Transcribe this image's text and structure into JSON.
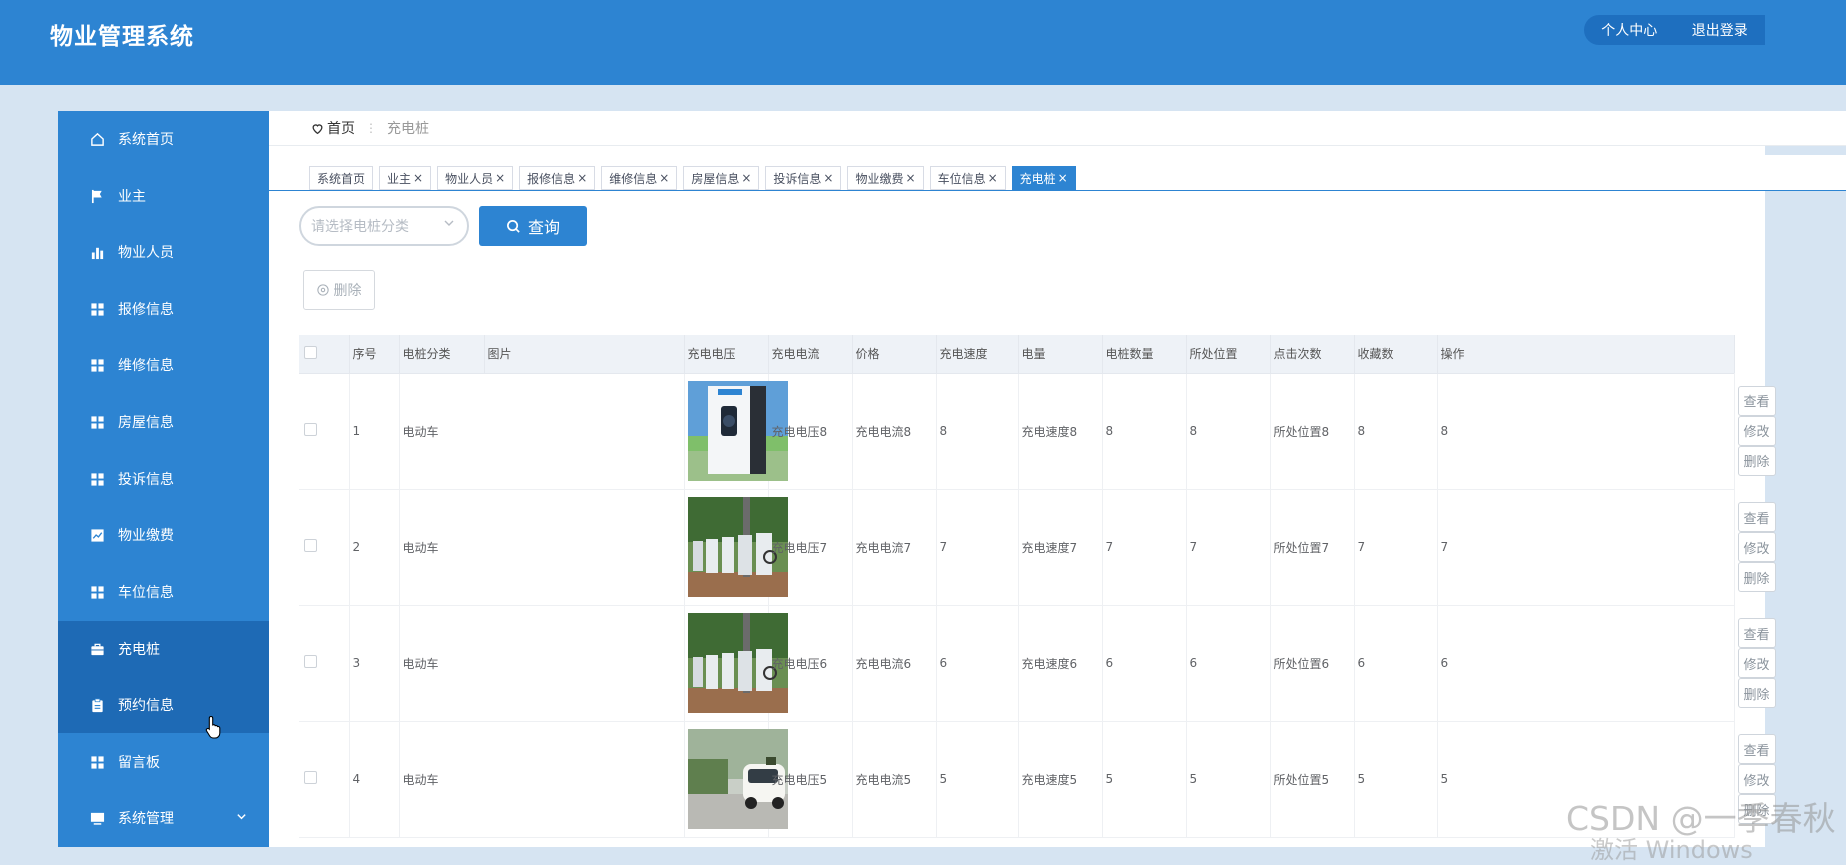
{
  "header": {
    "title": "物业管理系统",
    "nav": [
      "个人中心",
      "退出登录"
    ]
  },
  "sidebar": {
    "items": [
      {
        "label": "系统首页",
        "icon": "home-icon"
      },
      {
        "label": "业主",
        "icon": "flag-icon"
      },
      {
        "label": "物业人员",
        "icon": "bar-chart-icon"
      },
      {
        "label": "报修信息",
        "icon": "grid-icon"
      },
      {
        "label": "维修信息",
        "icon": "grid-icon"
      },
      {
        "label": "房屋信息",
        "icon": "grid-icon"
      },
      {
        "label": "投诉信息",
        "icon": "grid-icon"
      },
      {
        "label": "物业缴费",
        "icon": "trend-icon"
      },
      {
        "label": "车位信息",
        "icon": "grid-icon"
      },
      {
        "label": "充电桩",
        "icon": "briefcase-icon",
        "active": true
      },
      {
        "label": "预约信息",
        "icon": "clipboard-icon",
        "hover": true
      },
      {
        "label": "留言板",
        "icon": "grid-icon"
      },
      {
        "label": "系统管理",
        "icon": "monitor-icon",
        "expandable": true
      }
    ]
  },
  "breadcrumb": {
    "home": "首页",
    "current": "充电桩"
  },
  "tags": [
    {
      "label": "系统首页",
      "closable": false
    },
    {
      "label": "业主",
      "closable": true
    },
    {
      "label": "物业人员",
      "closable": true
    },
    {
      "label": "报修信息",
      "closable": true
    },
    {
      "label": "维修信息",
      "closable": true
    },
    {
      "label": "房屋信息",
      "closable": true
    },
    {
      "label": "投诉信息",
      "closable": true
    },
    {
      "label": "物业缴费",
      "closable": true
    },
    {
      "label": "车位信息",
      "closable": true
    },
    {
      "label": "充电桩",
      "closable": true,
      "active": true
    }
  ],
  "search": {
    "placeholder": "请选择电桩分类",
    "button": "查询"
  },
  "toolbar": {
    "delete": "删除"
  },
  "table": {
    "columns": [
      "序号",
      "电桩分类",
      "图片",
      "充电电压",
      "充电电流",
      "价格",
      "充电速度",
      "电量",
      "电桩数量",
      "所处位置",
      "点击次数",
      "收藏数",
      "操作"
    ],
    "actions": [
      "查看",
      "修改",
      "删除"
    ],
    "rows": [
      {
        "no": "1",
        "category": "电动车",
        "image": "charger-station",
        "voltage": "充电电压8",
        "current": "充电电流8",
        "price": "8",
        "speed": "充电速度8",
        "power": "8",
        "count": "8",
        "location": "所处位置8",
        "clicks": "8",
        "favorites": "8"
      },
      {
        "no": "2",
        "category": "电动车",
        "image": "charger-row-garden",
        "voltage": "充电电压7",
        "current": "充电电流7",
        "price": "7",
        "speed": "充电速度7",
        "power": "7",
        "count": "7",
        "location": "所处位置7",
        "clicks": "7",
        "favorites": "7"
      },
      {
        "no": "3",
        "category": "电动车",
        "image": "charger-row-garden",
        "voltage": "充电电压6",
        "current": "充电电流6",
        "price": "6",
        "speed": "充电速度6",
        "power": "6",
        "count": "6",
        "location": "所处位置6",
        "clicks": "6",
        "favorites": "6"
      },
      {
        "no": "4",
        "category": "电动车",
        "image": "car-charging",
        "voltage": "充电电压5",
        "current": "充电电流5",
        "price": "5",
        "speed": "充电速度5",
        "power": "5",
        "count": "5",
        "location": "所处位置5",
        "clicks": "5",
        "favorites": "5"
      }
    ]
  },
  "watermark": {
    "csdn": "CSDN @一季春秋",
    "windows": "激活 Windows"
  },
  "colors": {
    "primary": "#2d84d2",
    "active": "#1e6ab5",
    "bg": "#d6e4f2"
  }
}
